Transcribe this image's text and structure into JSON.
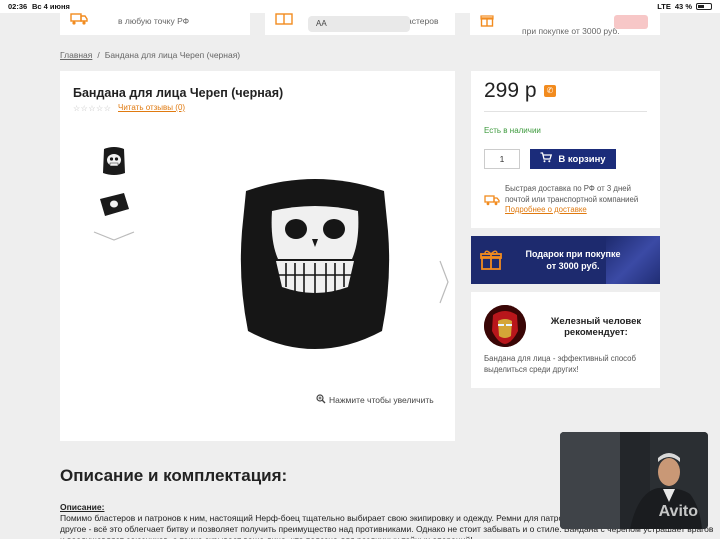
{
  "status_bar": {
    "time": "02:36",
    "date": "Вс 4 июня",
    "network": "LTE",
    "battery": "43 %"
  },
  "address_bar": {
    "text": "AA"
  },
  "top_features": [
    {
      "text": "в любую точку РФ"
    },
    {
      "text": "+коллекция редких бластеров"
    },
    {
      "line1": "",
      "line2": "при покупке от 3000 руб."
    }
  ],
  "breadcrumb": {
    "home": "Главная",
    "separator": "/",
    "current": "Бандана для лица Череп (черная)"
  },
  "product": {
    "title": "Бандана для лица Череп (черная)",
    "stars": "☆☆☆☆☆",
    "reviews_link": "Читать отзывы (0)",
    "zoom_hint": "Нажмите чтобы увеличить"
  },
  "purchase": {
    "price": "299 р",
    "stock": "Есть в наличии",
    "quantity": "1",
    "cart_button": "В корзину",
    "delivery_text": "Быстрая доставка по РФ от 3 дней почтой или транспортной компанией",
    "delivery_link": "Подробнее о доставке"
  },
  "promo": {
    "line1": "Подарок при покупке",
    "line2": "от 3000 руб."
  },
  "recommendation": {
    "title": "Железный человек рекомендует:",
    "text": "Бандана для лица - эффективный способ выделиться среди других!"
  },
  "description": {
    "heading": "Описание и комплектация:",
    "label": "Описание:",
    "body": "Помимо бластеров и патронов к ним, настоящий Нерф-боец тщательно выбирает свою экипировку и одежду. Ремни для патронов, сумки для бластеров, и многое другое - всё это облегчает битву и позволяет получить преимущество над противниками. Однако не стоит забывать и о стиле. Бандана с черепом устрашает врагов и воодушевляет союзников, а также скрывает ваше лицо, что полезно для различных тайных операций!"
  },
  "watermark": {
    "text": "Avito"
  },
  "colors": {
    "accent": "#f28b1e",
    "primary": "#1b2c7a",
    "stock": "#3d9a3d"
  }
}
